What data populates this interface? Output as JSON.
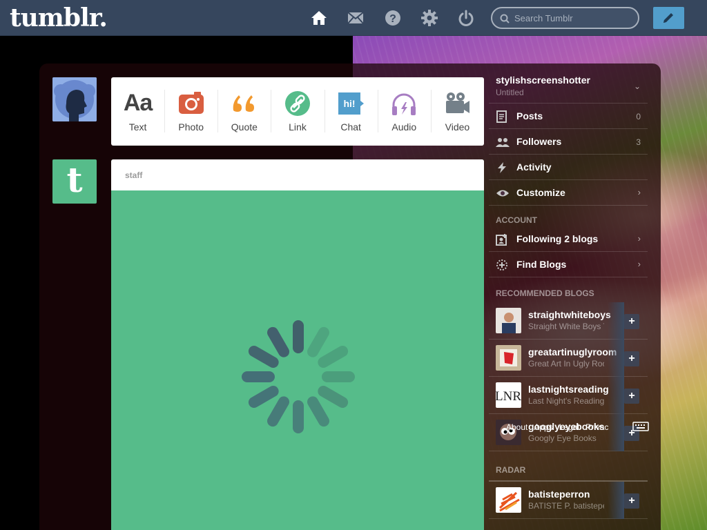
{
  "app": {
    "logo": "tumblr.",
    "search_placeholder": "Search Tumblr",
    "colors": {
      "nav_bg": "#36465d",
      "compose_bg": "#529ecc",
      "post_bg": "#56bc8a"
    }
  },
  "nav": {
    "icons": [
      "home-icon",
      "mail-icon",
      "help-icon",
      "gear-icon",
      "power-icon"
    ],
    "compose_icon": "pencil-icon"
  },
  "post_types": [
    {
      "label": "Text",
      "icon": "text-icon",
      "glyph": "Aa",
      "color": "#444444"
    },
    {
      "label": "Photo",
      "icon": "camera-icon",
      "color": "#d95e40"
    },
    {
      "label": "Quote",
      "icon": "quote-icon",
      "glyph": "““",
      "color": "#f2992e"
    },
    {
      "label": "Link",
      "icon": "link-icon",
      "color": "#56bc8a"
    },
    {
      "label": "Chat",
      "icon": "chat-icon",
      "glyph": "hi!",
      "color": "#529ecc"
    },
    {
      "label": "Audio",
      "icon": "headphones-icon",
      "color": "#a77dc2"
    },
    {
      "label": "Video",
      "icon": "video-camera-icon",
      "color": "#748089"
    }
  ],
  "post": {
    "author": "staff",
    "state": "loading"
  },
  "sidebar": {
    "blog": {
      "name": "stylishscreenshotter",
      "subtitle": "Untitled"
    },
    "menu": [
      {
        "label": "Posts",
        "icon": "posts-icon",
        "count": "0"
      },
      {
        "label": "Followers",
        "icon": "followers-icon",
        "count": "3"
      },
      {
        "label": "Activity",
        "icon": "lightning-icon",
        "count": ""
      },
      {
        "label": "Customize",
        "icon": "eye-icon",
        "count": ""
      }
    ],
    "account_heading": "ACCOUNT",
    "account_menu": [
      {
        "label": "Following 2 blogs",
        "icon": "following-icon"
      },
      {
        "label": "Find Blogs",
        "icon": "compass-icon"
      }
    ],
    "recommended_heading": "RECOMMENDED BLOGS",
    "recommended": [
      {
        "name": "straightwhiteboys",
        "subtitle": "Straight White Boys Te"
      },
      {
        "name": "greatartinuglyroom",
        "subtitle": "Great Art In Ugly Room"
      },
      {
        "name": "lastnightsreading",
        "subtitle": "Last Night's Reading"
      },
      {
        "name": "googlyeyebooks",
        "subtitle": "Googly Eye Books"
      }
    ],
    "follow_label": "+",
    "radar_heading": "RADAR",
    "radar": [
      {
        "name": "batisteperron",
        "subtitle": "BATISTE P. batisteper"
      }
    ]
  },
  "footer": {
    "links": [
      "About",
      "Apps",
      "Legal",
      "Privac"
    ],
    "keyboard_icon": "keyboard-icon"
  }
}
